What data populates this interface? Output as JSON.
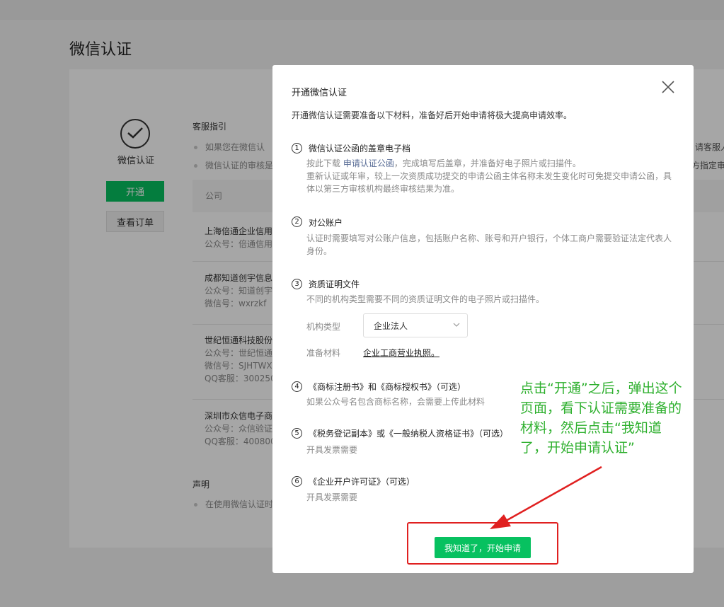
{
  "page": {
    "title": "微信认证"
  },
  "left": {
    "status_label": "微信认证",
    "open_button": "开通",
    "orders_button": "查看订单"
  },
  "guide": {
    "heading": "客服指引",
    "bullets": [
      "如果您在微信认",
      "微信认证的审核是"
    ],
    "right_fragments": [
      "请客服人",
      "方指定审"
    ]
  },
  "table": {
    "header": "公司",
    "rows": [
      {
        "name": "上海倍通企业信用",
        "lines": [
          "公众号：倍通信用"
        ]
      },
      {
        "name": "成都知道创宇信息",
        "lines": [
          "公众号：知道创宇",
          "微信号：wxrzkf"
        ]
      },
      {
        "name": "世纪恒通科技股份",
        "lines": [
          "公众号：世纪恒通",
          "微信号：SJHTWX",
          "QQ客服：300250"
        ]
      },
      {
        "name": "深圳市众信电子商",
        "lines": [
          "公众号：众信验证",
          "QQ客服：400800"
        ]
      }
    ]
  },
  "statement": {
    "heading": "声明",
    "bullet": "在使用微信认证时"
  },
  "dialog": {
    "title": "开通微信认证",
    "intro": "开通微信认证需要准备以下材料，准备好后开始申请将极大提高申请效率。",
    "items": [
      {
        "num": "1",
        "title": "微信认证公函的盖章电子档",
        "desc_prefix": "按此下载 ",
        "desc_link": "申请认证公函",
        "desc_suffix": "，完成填写后盖章，并准备好电子照片或扫描件。",
        "desc2": "重新认证或年审，较上一次资质成功提交的申请公函主体名称未发生变化时可免提交申请公函，具体以第三方审核机构最终审核结果为准。"
      },
      {
        "num": "2",
        "title": "对公账户",
        "desc": "认证时需要填写对公账户信息，包括账户名称、账号和开户银行，个体工商户需要验证法定代表人身份。"
      },
      {
        "num": "3",
        "title": "资质证明文件",
        "desc": "不同的机构类型需要不同的资质证明文件的电子照片或扫描件。"
      },
      {
        "num": "4",
        "title": "《商标注册书》和《商标授权书》（可选）",
        "desc": "如果公众号名包含商标名称，会需要上传此材料"
      },
      {
        "num": "5",
        "title": "《税务登记副本》或《一般纳税人资格证书》（可选）",
        "desc": "开具发票需要"
      },
      {
        "num": "6",
        "title": "《企业开户许可证》（可选）",
        "desc": "开具发票需要"
      }
    ],
    "org_type_label": "机构类型",
    "org_type_value": "企业法人",
    "materials_label": "准备材料",
    "materials_value": "企业工商营业执照。",
    "confirm_button": "我知道了，开始申请"
  },
  "annotation": {
    "text": "点击“开通”之后，弹出这个页面，看下认证需要准备的材料，然后点击“我知道了，开始申请认证”"
  },
  "colors": {
    "accent": "#07c160",
    "link": "#576b95",
    "annotation": "#2fb02f",
    "highlight": "#e02020"
  },
  "icons": [
    "check-circle-icon",
    "close-icon",
    "chevron-down-icon",
    "arrow-icon"
  ]
}
